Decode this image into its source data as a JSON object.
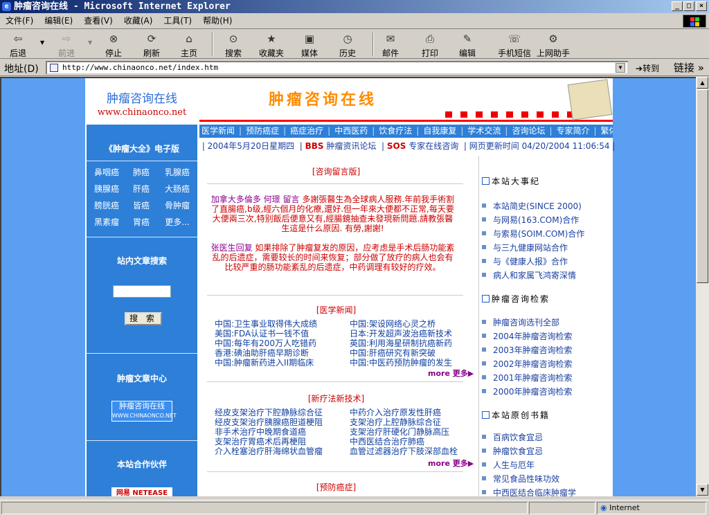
{
  "window": {
    "title": "肿瘤咨询在线 - Microsoft Internet Explorer"
  },
  "menu": [
    "文件(F)",
    "编辑(E)",
    "查看(V)",
    "收藏(A)",
    "工具(T)",
    "帮助(H)"
  ],
  "toolbar": {
    "back": "后退",
    "forward": "前进",
    "stop": "停止",
    "refresh": "刷新",
    "home": "主页",
    "search": "搜索",
    "favorites": "收藏夹",
    "media": "媒体",
    "history": "历史",
    "mail": "邮件",
    "print": "打印",
    "edit": "编辑",
    "sms": "手机短信",
    "helper": "上网助手"
  },
  "address": {
    "label": "地址(D)",
    "url": "http://www.chinaonco.net/index.htm",
    "go": "转到",
    "links": "链接"
  },
  "status": {
    "zone": "Internet"
  },
  "site": {
    "logo_cn": "肿瘤咨询在线",
    "logo_url": "www.chinaonco.net",
    "banner_title": "肿瘤咨询在线",
    "nav": [
      "医学新闻",
      "预防癌症",
      "癌症治疗",
      "中西医药",
      "饮食疗法",
      "自我康复",
      "学术交流",
      "咨询论坛",
      "专家简介",
      "繁体字版"
    ],
    "date": "2004年5月20日星期四",
    "bbs_tag": "BBS",
    "bbs_text": "肿瘤资讯论坛",
    "sos_tag": "SOS",
    "sos_text": "专家在线咨询",
    "update_label": "网页更新时间",
    "update_time": "04/20/2004 11:06:54",
    "left": {
      "encyclopedia": "《肿瘤大全》电子版",
      "cats": [
        "鼻咽癌",
        "肺癌",
        "乳腺癌",
        "胰腺癌",
        "肝癌",
        "大肠癌",
        "膀胱癌",
        "皆癌",
        "骨肿瘤",
        "黑素瘤",
        "胃癌",
        "更多..."
      ],
      "search_title": "站内文章搜索",
      "search_button": "搜 索",
      "article_center": "肿瘤文章中心",
      "article_logo": "肿瘤咨询在线",
      "article_logo_url": "WWW.CHINAONCO.NET",
      "partners": "本站合作伙伴",
      "netease": "网易 NETEASE"
    },
    "consult": {
      "title": "[咨询留言版]",
      "q_name": "加拿大多倫多 何璟 留言",
      "q_text": "多謝張醫生為全球病人服務.年前我手術割了直腸癌,b级,經六個月的化療,還好.但一年來大便都不正常,每天要大便兩三次,特别飯后便意又有,經腸鏡抽查未發現新問題.請教張醫生這是什么原因. 有勞,謝謝!",
      "a_name": "张医生回复",
      "a_text": "如果排除了肿瘤复发的原因，应考虑是手术后肠功能紊乱的后遗症，需要较长的时间来恢复；部分做了放疗的病人也会有比较严重的肠功能紊乱的后遗症，中药调理有较好的疗效。"
    },
    "news": {
      "title": "[医学新闻]",
      "left": [
        "中国:卫生事业取得伟大成绩",
        "美国:FDA认证书一钱不值",
        "中国:每年有200万人吃错药",
        "香港:碘油助肝癌早期诊断",
        "中国:肿瘤新药进入II期临床"
      ],
      "right": [
        "中国:架设网络心灵之桥",
        "日本:开发超声波治癌新技术",
        "英国:利用海星研制抗癌新药",
        "中国:肝癌研究有新突破",
        "中国:中医药预防肿瘤的发生"
      ],
      "more": "more 更多▶"
    },
    "therapy": {
      "title": "[新疗法新技术]",
      "left": [
        "经皮支架治疗下腔静脉综合征",
        "经皮支架治疗胰腺癌胆道梗阻",
        "非手术治疗中晚期食道癌",
        "支架治疗胃癌术后再梗阻",
        "介入栓塞治疗肝海绵状血管瘤"
      ],
      "right": [
        "中药介入治疗原发性肝癌",
        "支架治疗上腔静脉综合征",
        "支架治疗肝硬化门静脉高压",
        "中西医结合治疗肺癌",
        "血管过滤器治疗下肢深部血栓"
      ],
      "more": "more 更多▶"
    },
    "prevent": {
      "title": "[预防癌症]"
    },
    "right": {
      "events_title": "本站大事纪",
      "events": [
        "本站简史(SINCE 2000)",
        "与网易(163.COM)合作",
        "与索易(SOIM.COM)合作",
        "与三九健康网站合作",
        "与《健康人报》合作",
        "病人和家属飞鸿寄深情"
      ],
      "search_title": "肿瘤咨询检索",
      "searches": [
        "肿瘤咨询选刊全部",
        "2004年肿瘤咨询检索",
        "2003年肿瘤咨询检索",
        "2002年肿瘤咨询检索",
        "2001年肿瘤咨询检索",
        "2000年肿瘤咨询检索"
      ],
      "books_title": "本站原创书籍",
      "books": [
        "百病饮食宜忌",
        "肿瘤饮食宜忌",
        "人生与厄年",
        "常见食品性味功效",
        "中西医结合临床肿瘤学"
      ]
    }
  }
}
